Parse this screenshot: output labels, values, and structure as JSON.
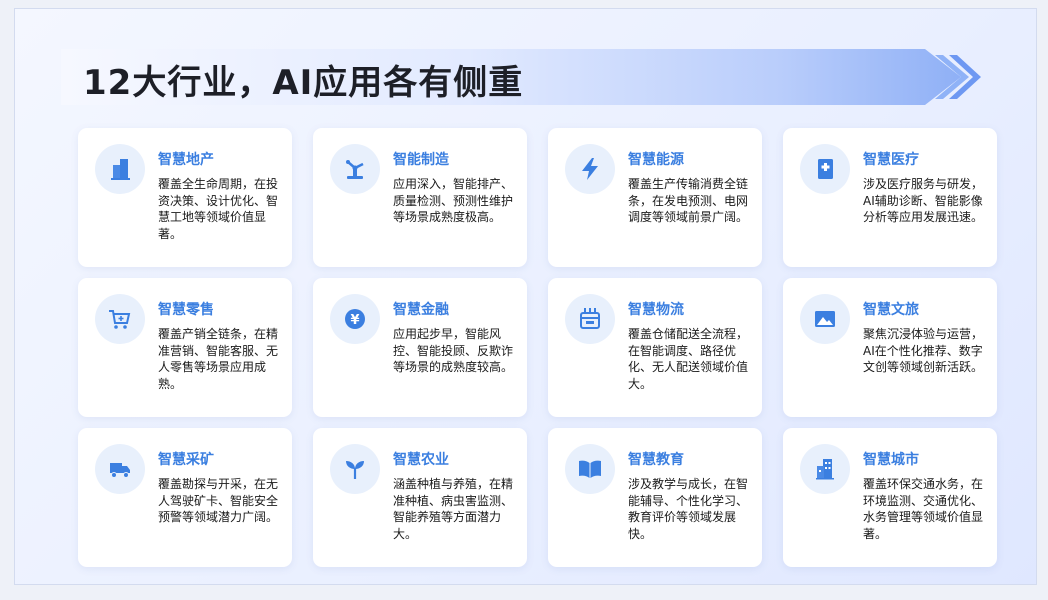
{
  "title": "12大行业，AI应用各有侧重",
  "colors": {
    "accent": "#3b7fe0",
    "icon_bg": "#e8f0fc",
    "card_bg": "#ffffff"
  },
  "cards": [
    {
      "icon": "building-icon",
      "title": "智慧地产",
      "desc": "覆盖全生命周期，在投资决策、设计优化、智慧工地等领域价值显著。"
    },
    {
      "icon": "robot-arm-icon",
      "title": "智能制造",
      "desc": "应用深入，智能排产、质量检测、预测性维护等场景成熟度极高。"
    },
    {
      "icon": "lightning-icon",
      "title": "智慧能源",
      "desc": "覆盖生产传输消费全链条，在发电预测、电网调度等领域前景广阔。"
    },
    {
      "icon": "medical-icon",
      "title": "智慧医疗",
      "desc": "涉及医疗服务与研发，AI辅助诊断、智能影像分析等应用发展迅速。"
    },
    {
      "icon": "shopping-cart-icon",
      "title": "智慧零售",
      "desc": "覆盖产销全链条，在精准营销、智能客服、无人零售等场景应用成熟。"
    },
    {
      "icon": "yuan-coin-icon",
      "title": "智慧金融",
      "desc": "应用起步早，智能风控、智能投顾、反欺诈等场景的成熟度较高。"
    },
    {
      "icon": "package-icon",
      "title": "智慧物流",
      "desc": "覆盖仓储配送全流程，在智能调度、路径优化、无人配送领域价值大。"
    },
    {
      "icon": "landscape-icon",
      "title": "智慧文旅",
      "desc": "聚焦沉浸体验与运营，AI在个性化推荐、数字文创等领域创新活跃。"
    },
    {
      "icon": "mining-truck-icon",
      "title": "智慧采矿",
      "desc": "覆盖勘探与开采，在无人驾驶矿卡、智能安全预警等领域潜力广阔。"
    },
    {
      "icon": "sprout-icon",
      "title": "智慧农业",
      "desc": "涵盖种植与养殖，在精准种植、病虫害监测、智能养殖等方面潜力大。"
    },
    {
      "icon": "open-book-icon",
      "title": "智慧教育",
      "desc": "涉及教学与成长，在智能辅导、个性化学习、教育评价等领域发展快。"
    },
    {
      "icon": "city-buildings-icon",
      "title": "智慧城市",
      "desc": "覆盖环保交通水务，在环境监测、交通优化、水务管理等领域价值显著。"
    }
  ]
}
